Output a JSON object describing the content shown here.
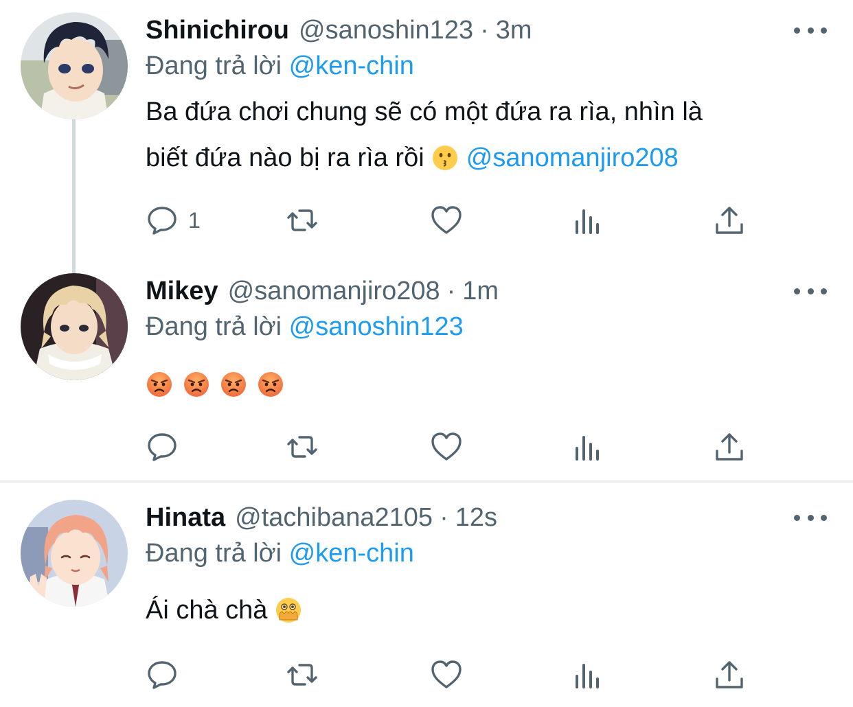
{
  "tweets": [
    {
      "name": "Shinichirou",
      "handle": "@sanoshin123",
      "dot": "·",
      "time": "3m",
      "reply_prefix": "Đang trả lời",
      "reply_mention": "@ken-chin",
      "text_line1": "Ba đứa chơi chung sẽ có một đứa ra rìa, nhìn là",
      "text_line2": "biết đứa nào bị ra rìa rồi",
      "text_emoji": "kissing-face-emoji",
      "text_mention": "@sanomanjiro208",
      "reply_count": "1",
      "avatar": "anime-boy-dark-hair"
    },
    {
      "name": "Mikey",
      "handle": "@sanomanjiro208",
      "dot": "·",
      "time": "1m",
      "reply_prefix": "Đang trả lời",
      "reply_mention": "@sanoshin123",
      "emojis": [
        "angry-face-emoji",
        "angry-face-emoji",
        "angry-face-emoji",
        "angry-face-emoji"
      ],
      "avatar": "anime-boy-blond-hair"
    },
    {
      "name": "Hinata",
      "handle": "@tachibana2105",
      "dot": "·",
      "time": "12s",
      "reply_prefix": "Đang trả lời",
      "reply_mention": "@ken-chin",
      "text": "Ái chà chà",
      "text_emoji": "face-with-open-eyes-and-hand-over-mouth-emoji",
      "avatar": "anime-girl-pink-hair"
    }
  ],
  "colors": {
    "mention": "#1d9bf0",
    "secondary_text": "#536471",
    "icon": "#536471",
    "thread_line": "#cfd9de",
    "divider": "#e8ecee"
  },
  "icons": [
    "reply-icon",
    "retweet-icon",
    "like-icon",
    "views-icon",
    "share-icon",
    "more-icon"
  ]
}
